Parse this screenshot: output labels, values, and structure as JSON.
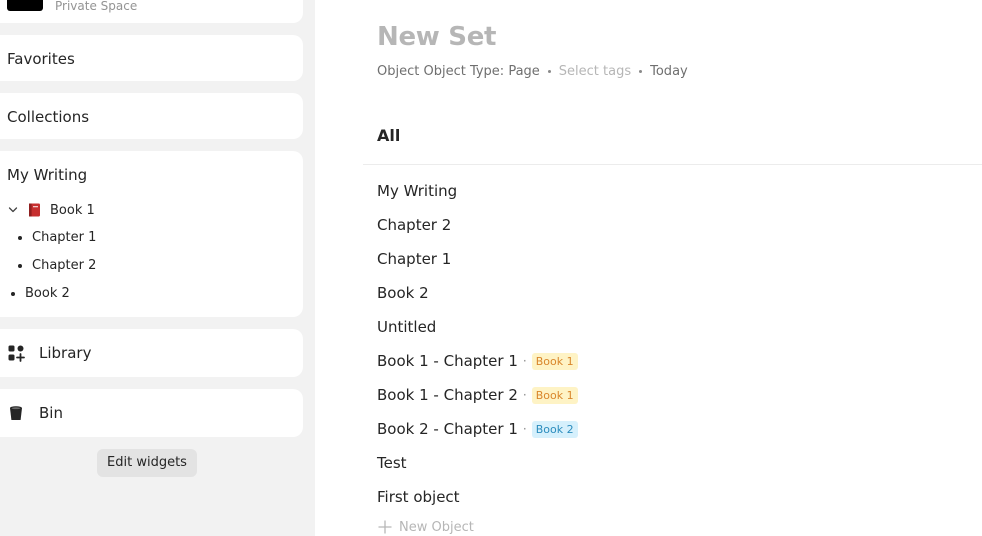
{
  "sidebar": {
    "space": {
      "subtitle": "Private Space"
    },
    "favorites": {
      "title": "Favorites"
    },
    "collections": {
      "title": "Collections"
    },
    "my_writing": {
      "title": "My Writing",
      "tree": {
        "book1": "Book 1",
        "chapter1": "Chapter 1",
        "chapter2": "Chapter 2",
        "book2": "Book 2"
      }
    },
    "library": {
      "title": "Library",
      "icon": "library-icon"
    },
    "bin": {
      "title": "Bin",
      "icon": "bin-icon"
    },
    "edit_widgets_label": "Edit widgets"
  },
  "main": {
    "title": "New Set",
    "meta": {
      "object_type": "Object Object Type: Page",
      "tags_placeholder": "Select tags",
      "date": "Today"
    },
    "view_title": "All",
    "objects": [
      {
        "name": "My Writing"
      },
      {
        "name": "Chapter 2"
      },
      {
        "name": "Chapter 1"
      },
      {
        "name": "Book 2"
      },
      {
        "name": "Untitled"
      },
      {
        "name": "Book 1 - Chapter 1",
        "separator": "·",
        "tag": "Book 1",
        "tag_color": "#fef3c5"
      },
      {
        "name": "Book 1 - Chapter 2",
        "separator": "·",
        "tag": "Book 1",
        "tag_color": "#fef3c5"
      },
      {
        "name": "Book 2 - Chapter 1",
        "separator": "·",
        "tag": "Book 2",
        "tag_color": "#d6f0fc"
      },
      {
        "name": "Test"
      },
      {
        "name": "First object"
      }
    ],
    "new_object_label": "New Object"
  },
  "colors": {
    "sidebar_bg": "#f2f2f2",
    "title_placeholder": "#b6b6b6",
    "tag_orange_text": "#d9862b",
    "tag_blue_text": "#2b8cbd"
  }
}
